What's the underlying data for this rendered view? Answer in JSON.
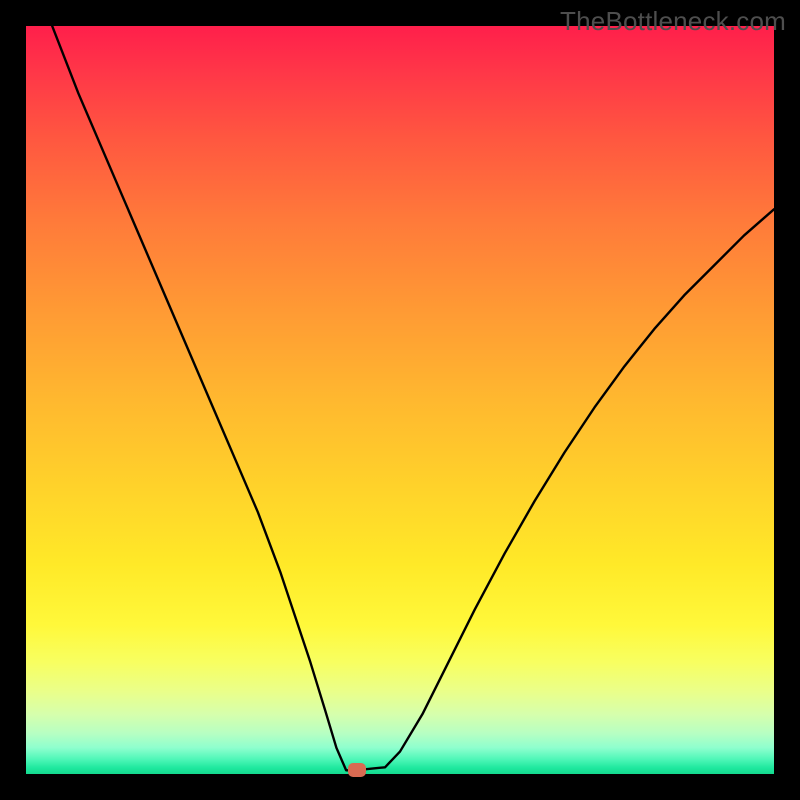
{
  "watermark": "TheBottleneck.com",
  "chart_data": {
    "type": "line",
    "title": "",
    "xlabel": "",
    "ylabel": "",
    "xlim": [
      0,
      100
    ],
    "ylim": [
      0,
      100
    ],
    "grid": false,
    "series": [
      {
        "name": "bottleneck-curve",
        "x": [
          3.5,
          7,
          10,
          13,
          16,
          19,
          22,
          25,
          28,
          31,
          34,
          36,
          38,
          40,
          41.5,
          42.8,
          44,
          48,
          50,
          53,
          56,
          60,
          64,
          68,
          72,
          76,
          80,
          84,
          88,
          92,
          96,
          100
        ],
        "values": [
          100,
          91,
          84,
          77,
          70,
          63,
          56,
          49,
          42,
          35,
          27,
          21,
          15,
          8.5,
          3.5,
          0.5,
          0.5,
          0.9,
          3,
          8,
          14,
          22,
          29.5,
          36.5,
          43,
          49,
          54.5,
          59.5,
          64,
          68,
          72,
          75.5
        ]
      }
    ],
    "minimum_marker": {
      "x": 44.2,
      "y": 0.6
    },
    "background_gradient": {
      "top": "#ff1f4b",
      "mid": "#ffe928",
      "bottom": "#14d98e"
    }
  }
}
